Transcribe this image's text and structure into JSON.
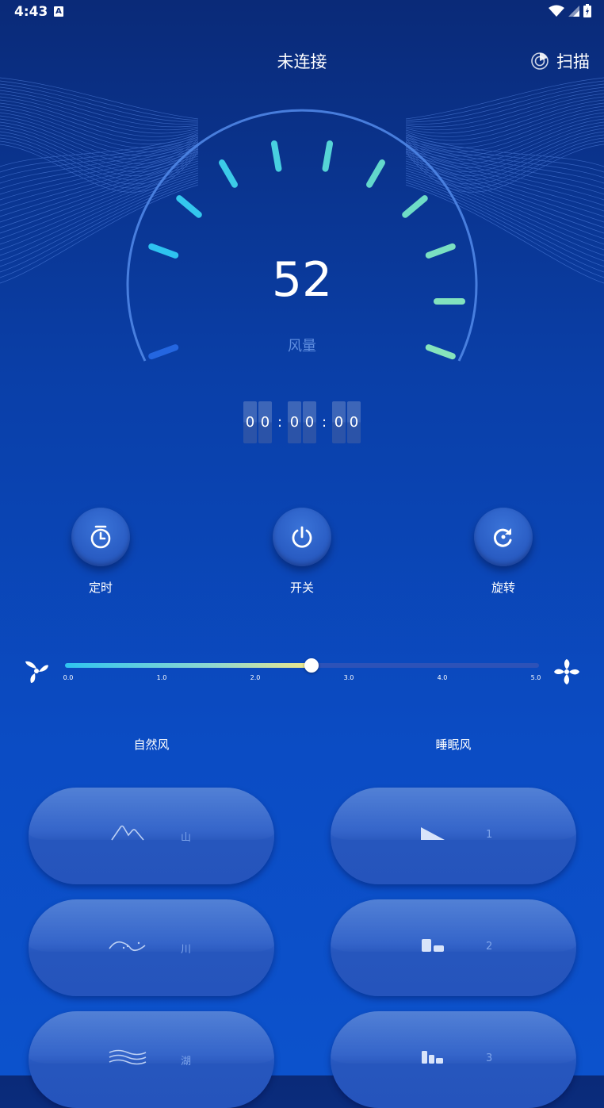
{
  "status": {
    "time": "4:43",
    "badge": "A"
  },
  "header": {
    "title": "未连接",
    "scan_label": "扫描"
  },
  "gauge": {
    "value": "52",
    "label": "风量"
  },
  "timer": {
    "digits": [
      "0",
      "0",
      "0",
      "0",
      "0",
      "0"
    ],
    "separator": ":"
  },
  "controls": [
    {
      "label": "定时",
      "icon": "timer-icon"
    },
    {
      "label": "开关",
      "icon": "power-icon"
    },
    {
      "label": "旋转",
      "icon": "rotate-icon"
    }
  ],
  "slider": {
    "value": 2.6,
    "min": 0.0,
    "max": 5.0,
    "ticks": [
      "0.0",
      "1.0",
      "2.0",
      "3.0",
      "4.0",
      "5.0"
    ]
  },
  "modes": {
    "natural": {
      "title": "自然风",
      "items": [
        {
          "label": "山",
          "icon": "mountain-icon"
        },
        {
          "label": "川",
          "icon": "river-icon"
        },
        {
          "label": "湖",
          "icon": "lake-icon"
        }
      ]
    },
    "sleep": {
      "title": "睡眠风",
      "items": [
        {
          "label": "1",
          "icon": "level-1-icon"
        },
        {
          "label": "2",
          "icon": "level-2-icon"
        },
        {
          "label": "3",
          "icon": "level-3-icon"
        }
      ]
    }
  },
  "colors": {
    "accent_cyan": "#2ec4f0",
    "accent_green": "#7ee0c0",
    "gauge_blue": "#1e4ec8"
  }
}
